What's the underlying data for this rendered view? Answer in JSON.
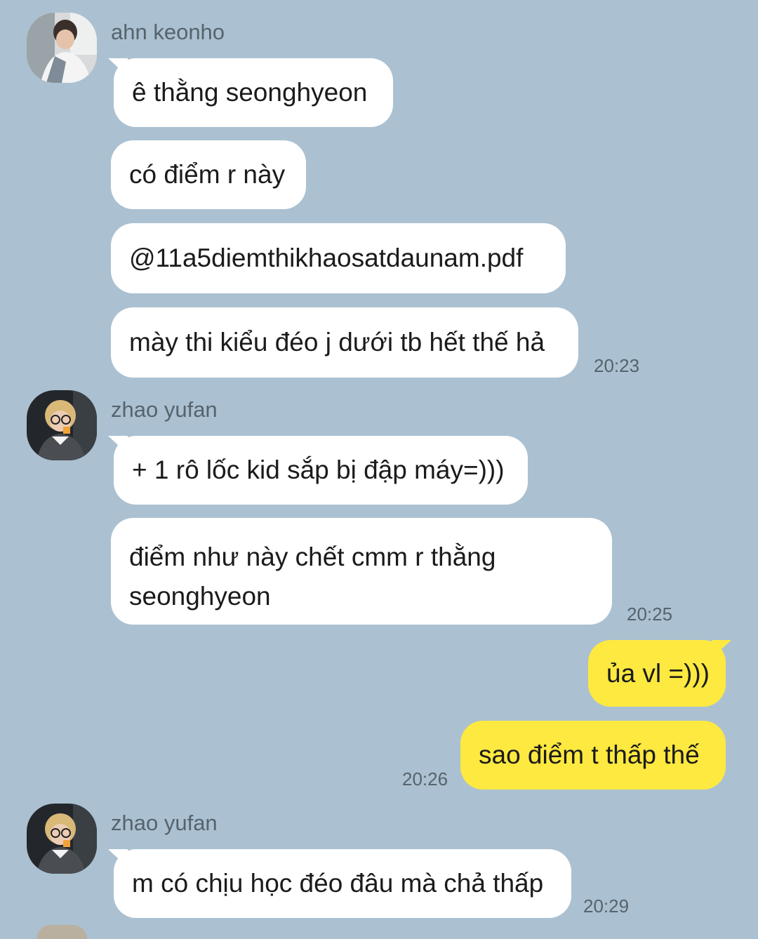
{
  "groups": [
    {
      "sender": "ahn keonho",
      "avatar_icon": "profile-photo-icon",
      "messages": [
        "ê thằng seonghyeon",
        "có điểm r này",
        "@11a5diemthikhaosatdaunam.pdf",
        "mày thi kiểu đéo j dưới tb hết thế hả"
      ],
      "time": "20:23"
    },
    {
      "sender": "zhao yufan",
      "avatar_icon": "profile-photo-icon",
      "messages": [
        "+ 1 rô lốc kid sắp bị đập máy=)))",
        "điểm như này chết cmm r thằng seonghyeon"
      ],
      "time": "20:25"
    },
    {
      "sender": "",
      "mine": true,
      "messages": [
        "ủa vl =)))",
        "sao điểm t thấp thế"
      ],
      "time": "20:26"
    },
    {
      "sender": "zhao yufan",
      "avatar_icon": "profile-photo-icon",
      "messages": [
        "m có chịu học đéo đâu mà chả thấp"
      ],
      "time": "20:29"
    }
  ],
  "colors": {
    "background": "#abc1d1",
    "incoming_bubble": "#ffffff",
    "outgoing_bubble": "#fee940",
    "meta_text": "#56636d"
  }
}
